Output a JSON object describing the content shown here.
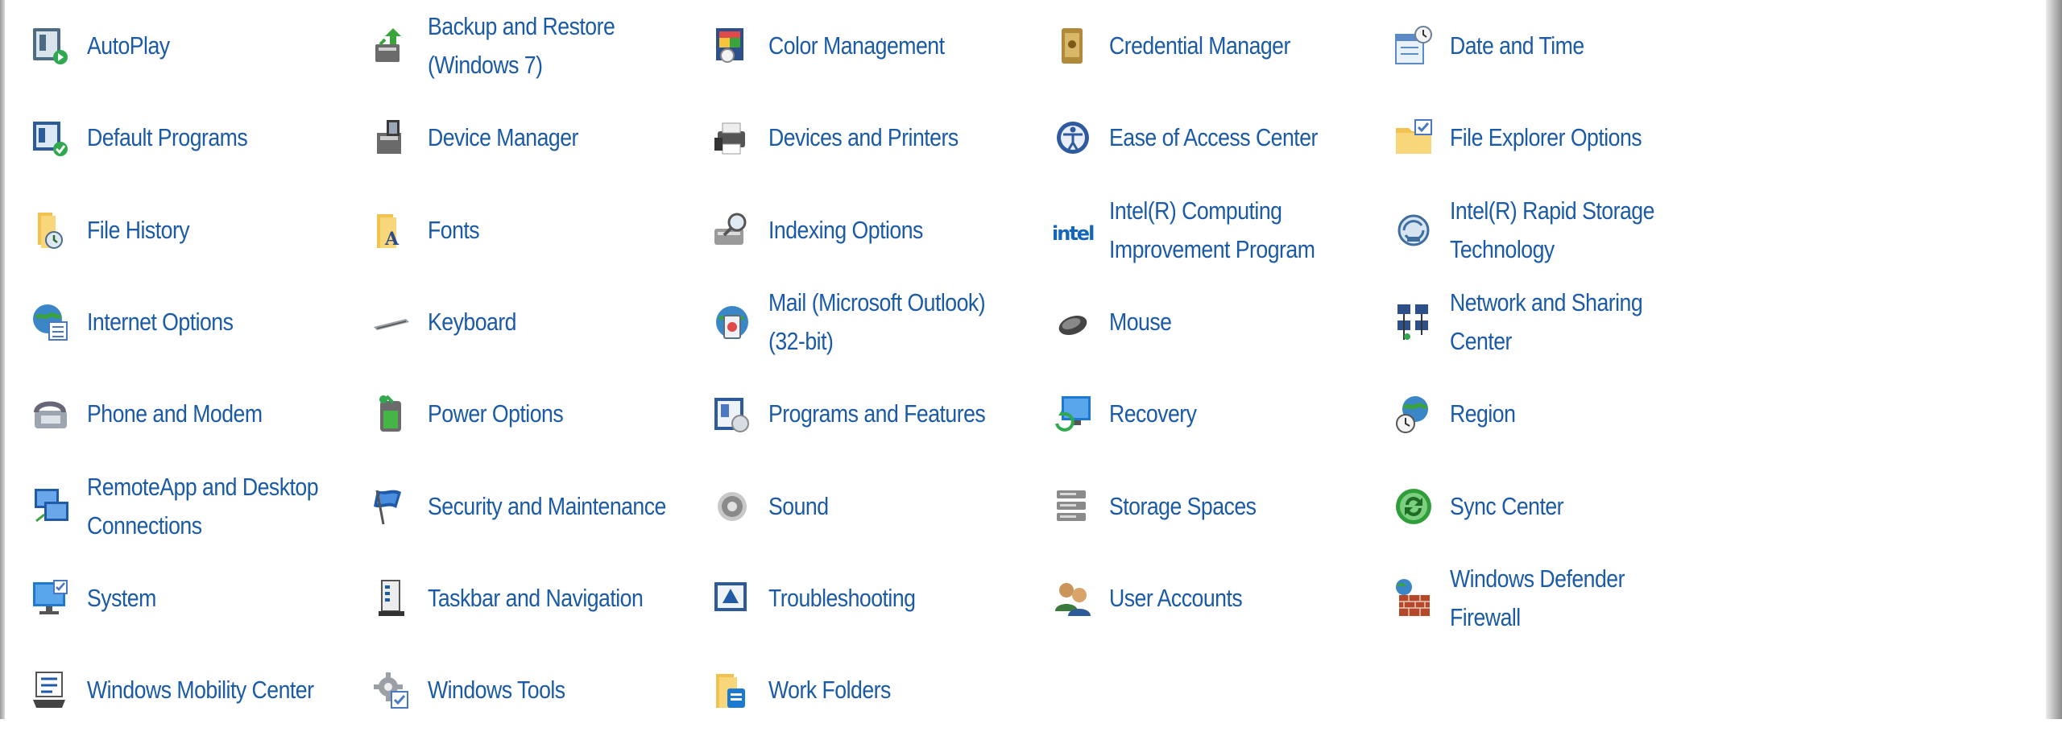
{
  "control_panel": {
    "items": [
      {
        "label": "AutoPlay",
        "icon": "autoplay-icon"
      },
      {
        "label": "Backup and Restore\n(Windows 7)",
        "icon": "backup-restore-icon"
      },
      {
        "label": "Color Management",
        "icon": "color-management-icon"
      },
      {
        "label": "Credential Manager",
        "icon": "credential-manager-icon"
      },
      {
        "label": "Date and Time",
        "icon": "date-time-icon"
      },
      {
        "label": "Default Programs",
        "icon": "default-programs-icon"
      },
      {
        "label": "Device Manager",
        "icon": "device-manager-icon"
      },
      {
        "label": "Devices and Printers",
        "icon": "devices-printers-icon"
      },
      {
        "label": "Ease of Access Center",
        "icon": "ease-of-access-icon"
      },
      {
        "label": "File Explorer Options",
        "icon": "file-explorer-options-icon"
      },
      {
        "label": "File History",
        "icon": "file-history-icon"
      },
      {
        "label": "Fonts",
        "icon": "fonts-icon"
      },
      {
        "label": "Indexing Options",
        "icon": "indexing-options-icon"
      },
      {
        "label": "Intel(R) Computing\nImprovement Program",
        "icon": "intel-logo-icon"
      },
      {
        "label": "Intel(R) Rapid Storage\nTechnology",
        "icon": "intel-rapid-storage-icon"
      },
      {
        "label": "Internet Options",
        "icon": "internet-options-icon"
      },
      {
        "label": "Keyboard",
        "icon": "keyboard-icon"
      },
      {
        "label": "Mail (Microsoft Outlook)\n(32-bit)",
        "icon": "mail-icon"
      },
      {
        "label": "Mouse",
        "icon": "mouse-icon"
      },
      {
        "label": "Network and Sharing\nCenter",
        "icon": "network-sharing-icon"
      },
      {
        "label": "Phone and Modem",
        "icon": "phone-modem-icon"
      },
      {
        "label": "Power Options",
        "icon": "power-options-icon"
      },
      {
        "label": "Programs and Features",
        "icon": "programs-features-icon"
      },
      {
        "label": "Recovery",
        "icon": "recovery-icon"
      },
      {
        "label": "Region",
        "icon": "region-icon"
      },
      {
        "label": "RemoteApp and Desktop\nConnections",
        "icon": "remoteapp-icon"
      },
      {
        "label": "Security and Maintenance",
        "icon": "security-maintenance-icon"
      },
      {
        "label": "Sound",
        "icon": "sound-icon"
      },
      {
        "label": "Storage Spaces",
        "icon": "storage-spaces-icon"
      },
      {
        "label": "Sync Center",
        "icon": "sync-center-icon"
      },
      {
        "label": "System",
        "icon": "system-icon"
      },
      {
        "label": "Taskbar and Navigation",
        "icon": "taskbar-navigation-icon"
      },
      {
        "label": "Troubleshooting",
        "icon": "troubleshooting-icon"
      },
      {
        "label": "User Accounts",
        "icon": "user-accounts-icon"
      },
      {
        "label": "Windows Defender\nFirewall",
        "icon": "firewall-icon"
      },
      {
        "label": "Windows Mobility Center",
        "icon": "mobility-center-icon"
      },
      {
        "label": "Windows Tools",
        "icon": "windows-tools-icon"
      },
      {
        "label": "Work Folders",
        "icon": "work-folders-icon"
      }
    ]
  },
  "colors": {
    "link_text": "#1a5aa6",
    "background": "#ffffff"
  }
}
